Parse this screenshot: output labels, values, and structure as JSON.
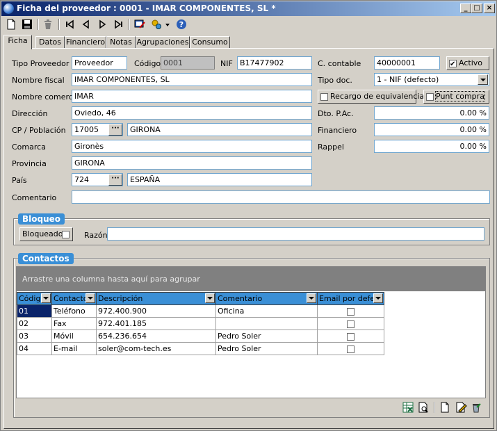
{
  "window": {
    "title": "Ficha del proveedor : 0001 - IMAR COMPONENTES, SL *",
    "minimize": "_",
    "maximize": "□",
    "close": "×"
  },
  "toolbar": {
    "icons": [
      "new-doc-icon",
      "save-icon",
      "delete-icon",
      "first-record-icon",
      "prev-record-icon",
      "next-record-icon",
      "last-record-icon",
      "customize-icon",
      "tools-icon",
      "help-icon"
    ]
  },
  "tabs": [
    "Ficha",
    "Datos",
    "Financiero",
    "Notas",
    "Agrupaciones",
    "Consumo"
  ],
  "form": {
    "tipo_proveedor_label": "Tipo Proveedor",
    "tipo_proveedor_value": "Proveedor",
    "codigo_label": "Código",
    "codigo_value": "0001",
    "nif_label": "NIF",
    "nif_value": "B17477902",
    "c_contable_label": "C. contable",
    "c_contable_value": "40000001",
    "activo_label": "Activo",
    "activo_checked": true,
    "nombre_fiscal_label": "Nombre fiscal",
    "nombre_fiscal_value": "IMAR COMPONENTES, SL",
    "tipo_doc_label": "Tipo doc.",
    "tipo_doc_value": "1 - NIF (defecto)",
    "nombre_comercial_label": "Nombre comercial",
    "nombre_comercial_value": "IMAR",
    "recargo_label": "Recargo de equivalencia",
    "punt_compra_label": "Punt compra",
    "direccion_label": "Dirección",
    "direccion_value": "Oviedo, 46",
    "dto_pac_label": "Dto. P.Ac.",
    "dto_pac_value": "0.00 %",
    "cp_label": "CP / Población",
    "cp_value": "17005",
    "poblacion_value": "GIRONA",
    "financiero_label": "Financiero",
    "financiero_value": "0.00 %",
    "comarca_label": "Comarca",
    "comarca_value": "Gironès",
    "rappel_label": "Rappel",
    "rappel_value": "0.00 %",
    "provincia_label": "Provincia",
    "provincia_value": "GIRONA",
    "pais_label": "País",
    "pais_code": "724",
    "pais_value": "ESPAÑA",
    "comentario_label": "Comentario",
    "comentario_value": "",
    "dots": "···"
  },
  "bloqueo": {
    "title": "Bloqueo",
    "bloqueado_label": "Bloqueado",
    "razon_label": "Razón",
    "razon_value": ""
  },
  "contactos": {
    "title": "Contactos",
    "group_hint": "Arrastre una columna hasta aquí para agrupar",
    "columns": [
      "Códig",
      "Contacto",
      "Descripción",
      "Comentario",
      "Email por defec"
    ],
    "rows": [
      {
        "codigo": "01",
        "contacto": "Teléfono",
        "descripcion": "972.400.900",
        "comentario": "Oficina"
      },
      {
        "codigo": "02",
        "contacto": "Fax",
        "descripcion": "972.401.185",
        "comentario": ""
      },
      {
        "codigo": "03",
        "contacto": "Móvil",
        "descripcion": "654.236.654",
        "comentario": "Pedro Soler"
      },
      {
        "codigo": "04",
        "contacto": "E-mail",
        "descripcion": "soler@com-tech.es",
        "comentario": "Pedro Soler"
      }
    ]
  },
  "bottom_icons": [
    "export-excel-icon",
    "print-preview-icon",
    "new-contact-icon",
    "edit-contact-icon",
    "delete-contact-icon"
  ]
}
